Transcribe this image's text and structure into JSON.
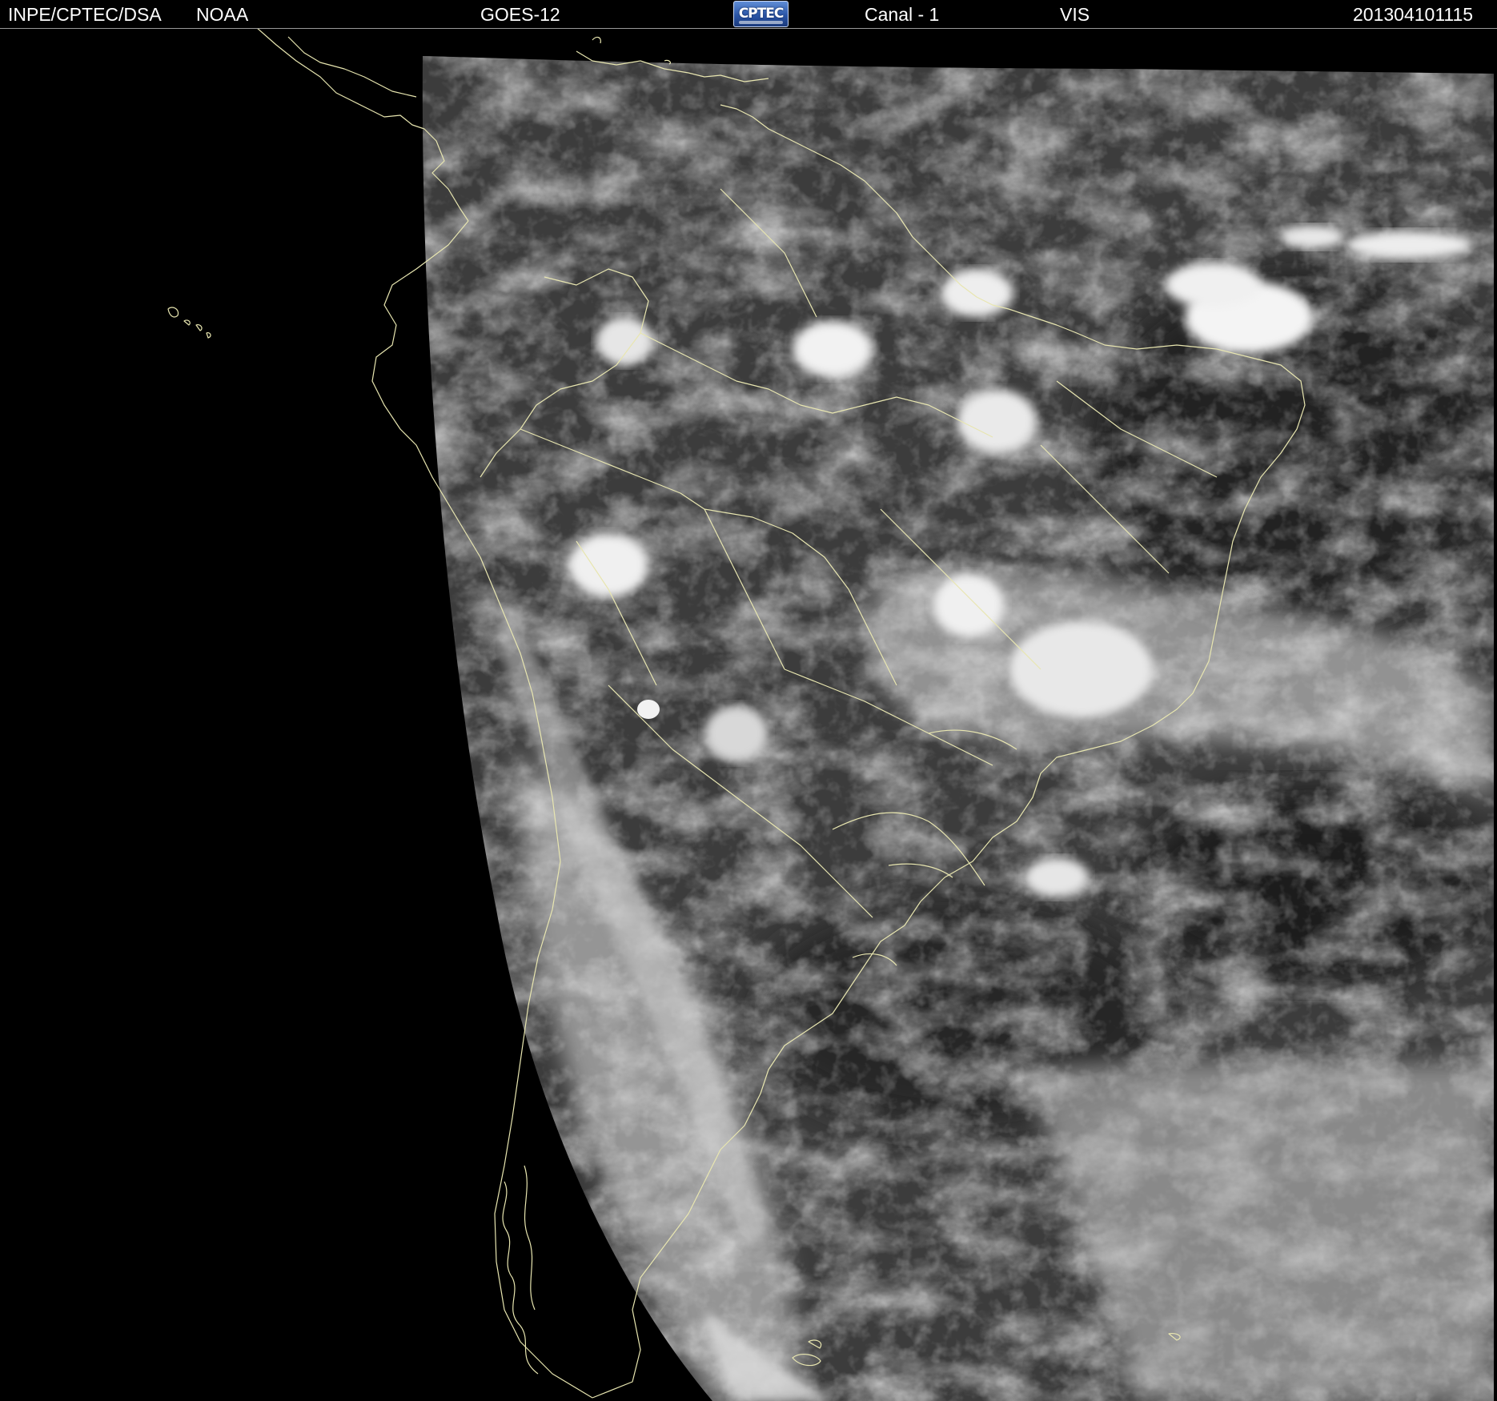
{
  "header": {
    "institution": "INPE/CPTEC/DSA",
    "agency": "NOAA",
    "satellite": "GOES-12",
    "logo_text": "CPTEC",
    "channel": "Canal - 1",
    "band": "VIS",
    "timestamp": "201304101115"
  },
  "colors": {
    "background": "#000000",
    "header_text": "#ffffff",
    "coastline": "#e8e6b0",
    "logo_blue": "#2b56a7"
  }
}
